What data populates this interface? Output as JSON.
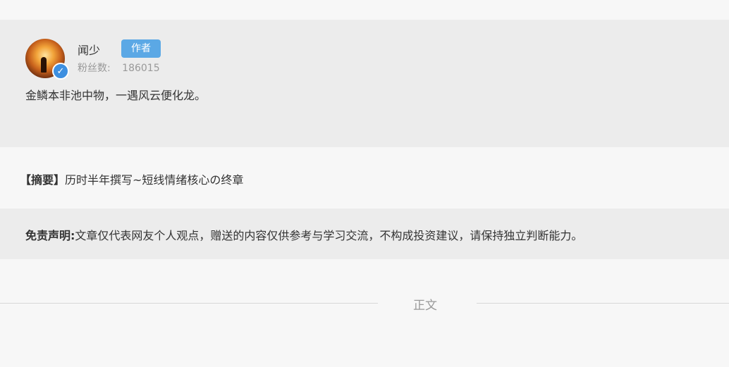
{
  "author": {
    "name": "闻少",
    "tag": "作者",
    "fans_label": "粉丝数:",
    "fans_count": "186015",
    "verified_icon": "verified-check-icon",
    "bio": "金鳞本非池中物，一遇风云便化龙。"
  },
  "summary": {
    "prefix": "【摘要】",
    "text": "历时半年撰写~短线情绪核心の终章"
  },
  "disclaimer": {
    "label": "免责声明:",
    "text": "文章仅代表网友个人观点，赠送的内容仅供参考与学习交流，不构成投资建议，请保持独立判断能力。"
  },
  "section_divider": {
    "label": "正文"
  },
  "colors": {
    "tag_background": "#5ba8e5",
    "verified_badge": "#3d8fe0",
    "card_background": "#ececec",
    "page_background": "#f7f7f7"
  }
}
